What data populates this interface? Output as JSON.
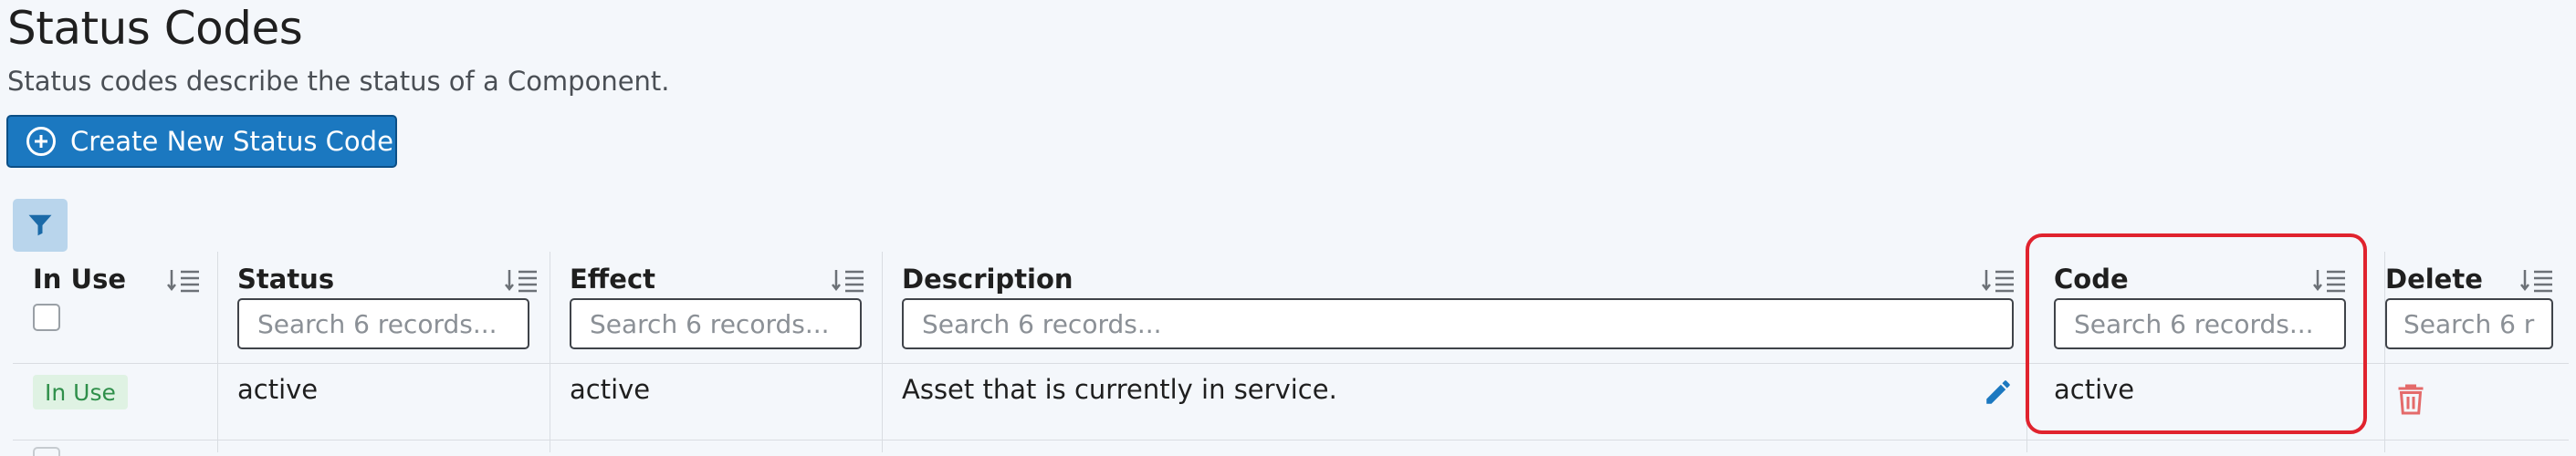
{
  "page": {
    "title": "Status Codes",
    "subtitle": "Status codes describe the status of a Component.",
    "create_button": "Create New Status Code"
  },
  "colors": {
    "primary": "#1b78c0",
    "filter_bg": "#b9d5ec",
    "badge_bg": "#dff2e3",
    "badge_text": "#2f8f4a",
    "delete": "#e46a6a",
    "highlight": "#e0232e"
  },
  "table": {
    "columns": {
      "in_use": "In Use",
      "status": "Status",
      "effect": "Effect",
      "description": "Description",
      "code": "Code",
      "delete": "Delete"
    },
    "search_placeholder": "Search 6 records...",
    "rows": [
      {
        "in_use": "In Use",
        "status": "active",
        "effect": "active",
        "description": "Asset that is currently in service.",
        "code": "active"
      }
    ]
  },
  "icons": {
    "create": "plus-circle-icon",
    "filter": "filter-icon",
    "sort": "sort-icon",
    "edit": "pencil-icon",
    "delete": "trash-icon"
  }
}
